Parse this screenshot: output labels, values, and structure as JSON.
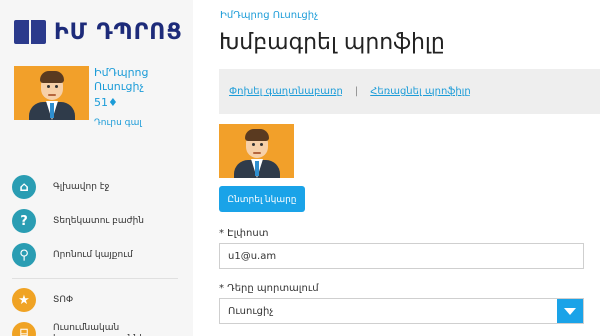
{
  "logo": {
    "text": "ԻՄ ԴՊՐՈՑ",
    "icon": "book-icon"
  },
  "profile": {
    "name": "ԻմԴպրոց Ուսուցիչ",
    "score": "51♦",
    "logout": "Դուրս գալ"
  },
  "nav": {
    "items": [
      {
        "label": "Գլխավոր էջ",
        "icon": "home-icon",
        "glyph": "⌂",
        "color": "#2a9db3"
      },
      {
        "label": "Տեղեկատու բաժին",
        "icon": "help-icon",
        "glyph": "?",
        "color": "#2a9db3"
      },
      {
        "label": "Որոնում կայքում",
        "icon": "search-icon",
        "glyph": "⚲",
        "color": "#2a9db3"
      },
      {
        "label": "ՏՈՓ",
        "icon": "star-icon",
        "glyph": "★",
        "color": "#f0a324"
      },
      {
        "label": "Ուսումնական հաստատություններ",
        "icon": "institution-icon",
        "glyph": "⌸",
        "color": "#f0a324"
      }
    ]
  },
  "breadcrumb": "ԻմԴպրոց Ուսուցիչ",
  "page_title": "Խմբագրել պրոֆիլը",
  "subnav": {
    "change_password": "Փոխել գաղտնաբառը",
    "separator": "|",
    "delete_profile": "Հեռացնել պրոֆիլը"
  },
  "choose_image_button": "Ընտրել նկարը",
  "email": {
    "label": "* Էլփոստ",
    "value": "u1@u.am"
  },
  "role": {
    "label": "* Դերը պորտալում",
    "value": "Ուսուցիչ"
  },
  "colors": {
    "accent": "#1aa3e8",
    "link": "#1c9cd8",
    "nav_teal": "#2a9db3",
    "nav_orange": "#f0a324",
    "logo": "#1d2b7a"
  }
}
